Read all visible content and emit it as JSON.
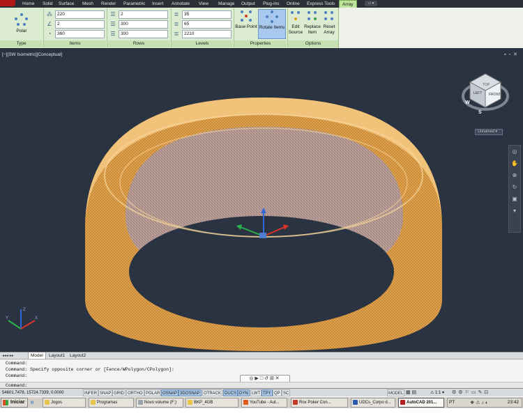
{
  "ribbon": {
    "tabs": [
      "Home",
      "Solid",
      "Surface",
      "Mesh",
      "Render",
      "Parametric",
      "Insert",
      "Annotate",
      "View",
      "Manage",
      "Output",
      "Plug-ins",
      "Online",
      "Express Tools",
      "Array"
    ],
    "active_tab": "Array",
    "type_panel": {
      "button_label": "Polar",
      "title": "Type"
    },
    "items_panel": {
      "title": "Items",
      "items": "220",
      "between": "2",
      "fill": "360"
    },
    "rows_panel": {
      "title": "Rows",
      "rows": "2",
      "between": "300",
      "total": "300"
    },
    "levels_panel": {
      "title": "Levels",
      "levels": "35",
      "between": "65",
      "total": "2210"
    },
    "properties_panel": {
      "title": "Properties",
      "base_point": "Base Point",
      "rotate_items": "Rotate Items"
    },
    "options_panel": {
      "title": "Options",
      "edit_source_1": "Edit",
      "edit_source_2": "Source",
      "replace_item_1": "Replace",
      "replace_item_2": "Item",
      "reset_array_1": "Reset",
      "reset_array_2": "Array"
    }
  },
  "viewport": {
    "label": "[−][SW Isometric][Conceptual]",
    "viewcube": {
      "left": "LEFT",
      "front": "FRONT",
      "top": "TOP",
      "compass_w": "W",
      "compass_s": "S"
    },
    "ucs_label": "Unnamed"
  },
  "layout_tabs": [
    "Model",
    "Layout1",
    "Layout2"
  ],
  "command": {
    "lines": [
      "Command:",
      "Command: Specify opposite corner or [Fence/WPolygon/CPolygon]:",
      "Command:"
    ],
    "prompt": "Command:"
  },
  "status": {
    "coords": "54601.7478, 15724.7339, 0.0000",
    "toggles": [
      {
        "label": "INFER",
        "on": false
      },
      {
        "label": "SNAP",
        "on": false
      },
      {
        "label": "GRID",
        "on": false
      },
      {
        "label": "ORTHO",
        "on": false
      },
      {
        "label": "POLAR",
        "on": false
      },
      {
        "label": "OSNAP",
        "on": true
      },
      {
        "label": "3DOSNAP",
        "on": true
      },
      {
        "label": "OTRACK",
        "on": false
      },
      {
        "label": "DUCS",
        "on": true
      },
      {
        "label": "DYN",
        "on": true
      },
      {
        "label": "LWT",
        "on": false
      },
      {
        "label": "TPY",
        "on": true
      },
      {
        "label": "QP",
        "on": false
      },
      {
        "label": "SC",
        "on": false
      }
    ],
    "model": "MODEL",
    "scale": "1:1"
  },
  "taskbar": {
    "start": "Iniciar",
    "tasks": [
      "Jogos",
      "Programas",
      "Novo volume (F:)",
      "BKP_4GB",
      "YouTube - Aut...",
      "Rox Poker Con...",
      "UDCs_Corpo d...",
      "AutoCAD 201..."
    ],
    "lang": "PT",
    "clock": "23:42"
  },
  "colors": {
    "ribbon_green": "#dcecd0",
    "viewport_bg": "#2a3342",
    "ring_orange": "#e7ad55",
    "ring_inner": "#a87d84"
  }
}
